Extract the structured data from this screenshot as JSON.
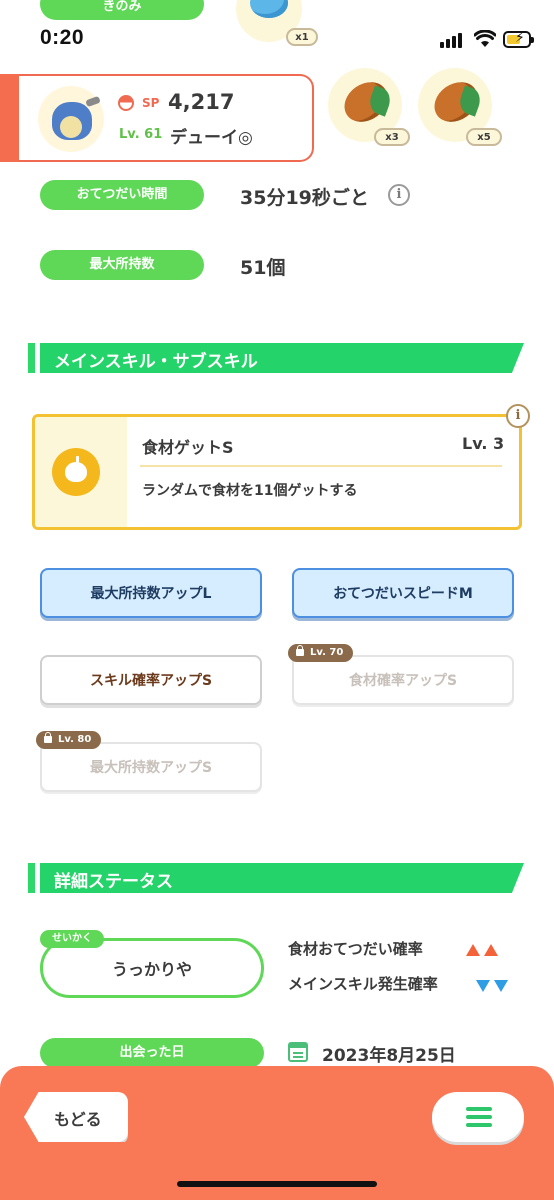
{
  "status_bar": {
    "time": "0:20"
  },
  "top": {
    "category_label": "きのみ",
    "berry_qty": "x1"
  },
  "pokemon": {
    "sp_label": "SP",
    "sp_value": "4,217",
    "level": "Lv. 61",
    "name": "デューイ◎",
    "ingredients": [
      {
        "icon": "cacao-bean-icon",
        "qty": "x3"
      },
      {
        "icon": "cacao-bean-icon",
        "qty": "x5"
      }
    ]
  },
  "info": {
    "help_time_label": "おてつだい時間",
    "help_time_value": "35分19秒ごと",
    "max_carry_label": "最大所持数",
    "max_carry_value": "51個"
  },
  "skills_section": {
    "title": "メインスキル・サブスキル",
    "main_skill": {
      "name": "食材ゲットS",
      "level": "Lv. 3",
      "description": "ランダムで食材を11個ゲットする",
      "icon": "apple-icon"
    },
    "sub_skills": [
      {
        "label": "最大所持数アップL",
        "state": "active"
      },
      {
        "label": "おてつだいスピードM",
        "state": "active"
      },
      {
        "label": "スキル確率アップS",
        "state": "unlocked"
      },
      {
        "label": "食材確率アップS",
        "state": "locked",
        "unlock_level": "Lv. 70"
      },
      {
        "label": "最大所持数アップS",
        "state": "locked",
        "unlock_level": "Lv. 80"
      }
    ]
  },
  "detail_section": {
    "title": "詳細ステータス",
    "nature_tag": "せいかく",
    "nature_value": "うっかりや",
    "up_stat": "食材おてつだい確率",
    "down_stat": "メインスキル発生確率",
    "met_label": "出会った日",
    "met_date": "2023年8月25日"
  },
  "nav": {
    "back_label": "もどる"
  },
  "colors": {
    "accent_green": "#5fd857",
    "section_green": "#24d36a",
    "bottom_bar": "#f97856",
    "skill_border": "#f2c232",
    "active_blue": "#4d8fe0"
  }
}
